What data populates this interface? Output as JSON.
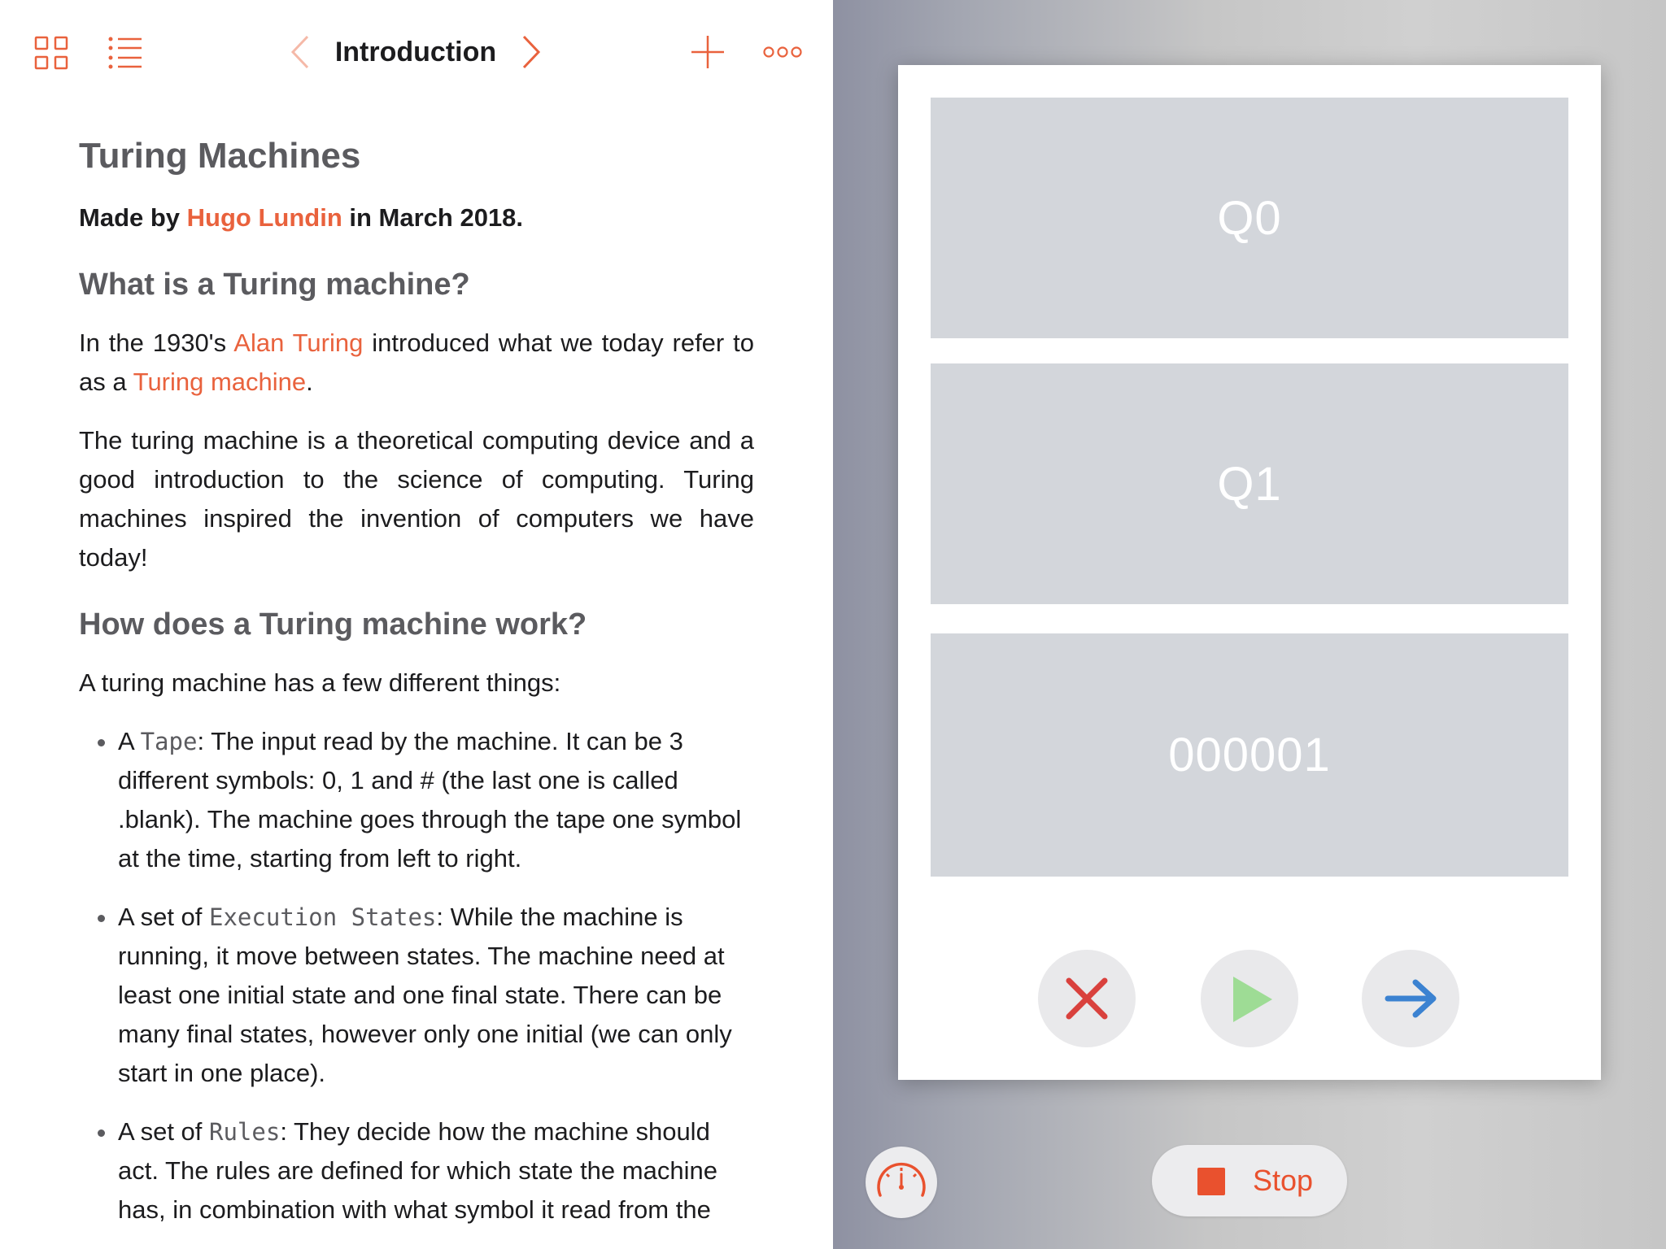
{
  "nav": {
    "title": "Introduction",
    "icons": [
      "grid-icon",
      "list-icon",
      "chevron-left-icon",
      "chevron-right-icon",
      "plus-icon",
      "more-icon"
    ]
  },
  "doc": {
    "title": "Turing Machines",
    "byline": {
      "pre": "Made by ",
      "author": "Hugo Lundin",
      "post": " in March 2018."
    },
    "h2_what": "What is a Turing machine?",
    "intro": {
      "p1": "In the 1930's ",
      "link1": "Alan Turing",
      "p2": " introduced what we today refer to as a ",
      "link2": "Turing machine",
      "p3": "."
    },
    "para2": "The turing machine is a theoretical computing device and a good introduction to the science of computing. Turing machines inspired the invention of computers we have today!",
    "h2_how": "How does a Turing machine work?",
    "lead": "A turing machine has a few different things:",
    "bullets": [
      {
        "pre": "A ",
        "code": "Tape",
        "text": ": The input read by the machine. It can be 3 different symbols: 0, 1 and # (the last one is called .blank). The machine goes through the tape one symbol at the time, starting from left to right."
      },
      {
        "pre": "A set of ",
        "code": "Execution States",
        "text": ": While the machine is running, it move between states. The machine need at least one initial state and one final state. There can be many final states, however only one initial (we can only start in one place)."
      },
      {
        "pre": "A set of ",
        "code": "Rules",
        "text": ": They decide how the machine should act. The rules are defined for which state the machine has, in combination with what symbol it read from the"
      }
    ]
  },
  "live": {
    "states": {
      "current": "Q0",
      "next": "Q1",
      "tape": "000001"
    },
    "buttons": [
      "reset-icon",
      "play-icon",
      "step-forward-icon"
    ]
  },
  "toolbar": {
    "stop_label": "Stop",
    "speed_icon": "speedometer-icon"
  },
  "colors": {
    "accent": "#e9623d",
    "stop": "#e9512e",
    "reset_red": "#d9413d",
    "play_green": "#9edc95",
    "step_blue": "#3b82d1",
    "state_box": "#d3d6db"
  }
}
